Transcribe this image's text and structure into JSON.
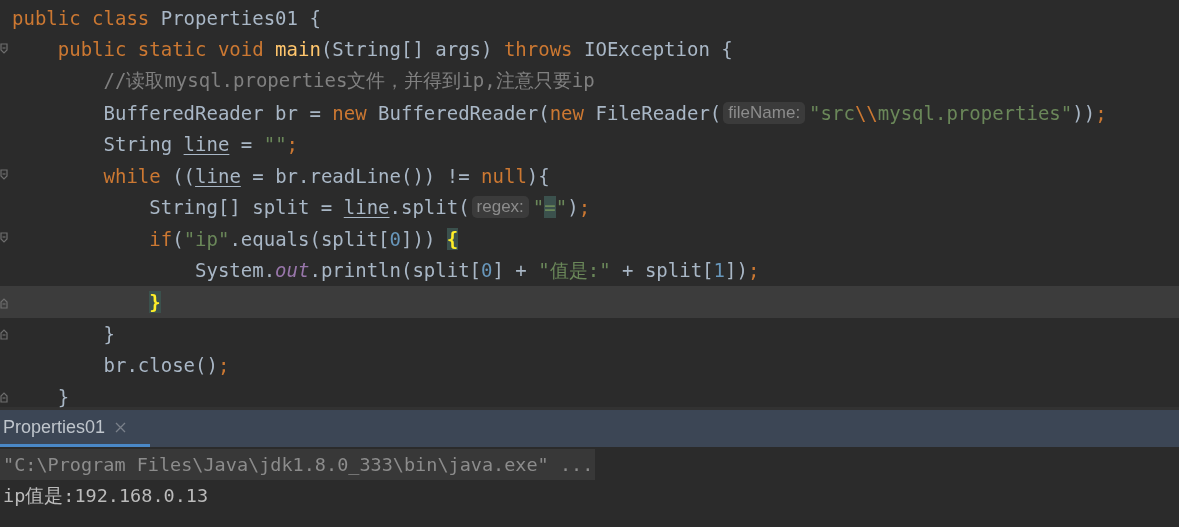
{
  "editor": {
    "lines": [
      {
        "fold_open": false,
        "fold_close": false,
        "current": false,
        "tokens": [
          {
            "kind": "keyword",
            "text": "public class"
          },
          {
            "kind": "plain",
            "text": " Properties01 {"
          }
        ]
      },
      {
        "fold_open": true,
        "fold_close": false,
        "current": false,
        "tokens": [
          {
            "kind": "keyword",
            "text": "    public static void "
          },
          {
            "kind": "method",
            "text": "main"
          },
          {
            "kind": "plain",
            "text": "(String[] args) "
          },
          {
            "kind": "keyword",
            "text": "throws"
          },
          {
            "kind": "plain",
            "text": " IOException {"
          }
        ]
      },
      {
        "fold_open": false,
        "fold_close": false,
        "current": false,
        "tokens": [
          {
            "kind": "comment",
            "text": "        //读取mysql.properties文件，并得到ip,注意只要ip"
          }
        ]
      },
      {
        "fold_open": false,
        "fold_close": false,
        "current": false,
        "tokens": [
          {
            "kind": "plain",
            "text": "        BufferedReader br = "
          },
          {
            "kind": "keyword",
            "text": "new"
          },
          {
            "kind": "plain",
            "text": " BufferedReader("
          },
          {
            "kind": "keyword",
            "text": "new"
          },
          {
            "kind": "plain",
            "text": " FileReader("
          },
          {
            "kind": "hint",
            "text": "fileName:"
          },
          {
            "kind": "string",
            "text": "\"src"
          },
          {
            "kind": "escape",
            "text": "\\\\"
          },
          {
            "kind": "string",
            "text": "mysql.properties\""
          },
          {
            "kind": "plain",
            "text": "))"
          },
          {
            "kind": "semicolon",
            "text": ";"
          }
        ]
      },
      {
        "fold_open": false,
        "fold_close": false,
        "current": false,
        "tokens": [
          {
            "kind": "plain",
            "text": "        String "
          },
          {
            "kind": "variable",
            "text": "line"
          },
          {
            "kind": "plain",
            "text": " = "
          },
          {
            "kind": "string",
            "text": "\"\""
          },
          {
            "kind": "semicolon",
            "text": ";"
          }
        ]
      },
      {
        "fold_open": true,
        "fold_close": false,
        "current": false,
        "tokens": [
          {
            "kind": "keyword",
            "text": "        while"
          },
          {
            "kind": "plain",
            "text": " (("
          },
          {
            "kind": "variable",
            "text": "line"
          },
          {
            "kind": "plain",
            "text": " = br.readLine()) != "
          },
          {
            "kind": "keyword",
            "text": "null"
          },
          {
            "kind": "plain",
            "text": "){"
          }
        ]
      },
      {
        "fold_open": false,
        "fold_close": false,
        "current": false,
        "tokens": [
          {
            "kind": "plain",
            "text": "            String[] split = "
          },
          {
            "kind": "variable",
            "text": "line"
          },
          {
            "kind": "plain",
            "text": ".split("
          },
          {
            "kind": "hint",
            "text": "regex:"
          },
          {
            "kind": "string",
            "text": "\""
          },
          {
            "kind": "string_match",
            "text": "="
          },
          {
            "kind": "string",
            "text": "\""
          },
          {
            "kind": "plain",
            "text": ")"
          },
          {
            "kind": "semicolon",
            "text": ";"
          }
        ]
      },
      {
        "fold_open": true,
        "fold_close": false,
        "current": false,
        "tokens": [
          {
            "kind": "keyword",
            "text": "            if"
          },
          {
            "kind": "plain",
            "text": "("
          },
          {
            "kind": "string",
            "text": "\"ip\""
          },
          {
            "kind": "plain",
            "text": ".equals(split["
          },
          {
            "kind": "number",
            "text": "0"
          },
          {
            "kind": "plain",
            "text": "])) "
          },
          {
            "kind": "brace_match",
            "text": "{"
          }
        ]
      },
      {
        "fold_open": false,
        "fold_close": false,
        "current": false,
        "tokens": [
          {
            "kind": "plain",
            "text": "                System."
          },
          {
            "kind": "field",
            "text": "out"
          },
          {
            "kind": "plain",
            "text": ".println(split["
          },
          {
            "kind": "number",
            "text": "0"
          },
          {
            "kind": "plain",
            "text": "] + "
          },
          {
            "kind": "string",
            "text": "\"值是:\""
          },
          {
            "kind": "plain",
            "text": " + split["
          },
          {
            "kind": "number",
            "text": "1"
          },
          {
            "kind": "plain",
            "text": "])"
          },
          {
            "kind": "semicolon",
            "text": ";"
          }
        ]
      },
      {
        "fold_open": false,
        "fold_close": true,
        "current": true,
        "tokens": [
          {
            "kind": "brace_match",
            "text": "            }"
          }
        ]
      },
      {
        "fold_open": false,
        "fold_close": true,
        "current": false,
        "tokens": [
          {
            "kind": "plain",
            "text": "        }"
          }
        ]
      },
      {
        "fold_open": false,
        "fold_close": false,
        "current": false,
        "tokens": [
          {
            "kind": "plain",
            "text": "        br.close()"
          },
          {
            "kind": "semicolon",
            "text": ";"
          }
        ]
      },
      {
        "fold_open": false,
        "fold_close": true,
        "current": false,
        "tokens": [
          {
            "kind": "plain",
            "text": "    }"
          }
        ]
      }
    ]
  },
  "run_panel": {
    "tabs": [
      {
        "label": "Properties01",
        "selected": true
      }
    ],
    "console": [
      {
        "kind": "command",
        "text": "\"C:\\Program Files\\Java\\jdk1.8.0_333\\bin\\java.exe\" ..."
      },
      {
        "kind": "output",
        "text": "ip值是:192.168.0.13"
      }
    ]
  }
}
